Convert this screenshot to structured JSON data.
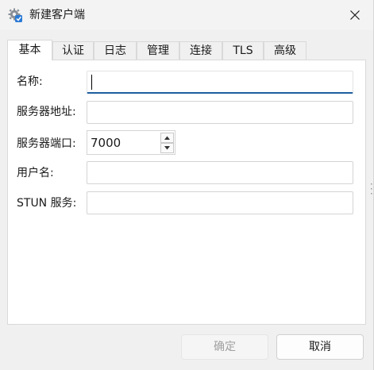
{
  "window": {
    "title": "新建客户端"
  },
  "icons": {
    "app": "gear-check-icon",
    "close": "close-icon",
    "spin_up": "caret-up-icon",
    "spin_down": "caret-down-icon"
  },
  "tabs": [
    {
      "label": "基本",
      "active": true
    },
    {
      "label": "认证",
      "active": false
    },
    {
      "label": "日志",
      "active": false
    },
    {
      "label": "管理",
      "active": false
    },
    {
      "label": "连接",
      "active": false
    },
    {
      "label": "TLS",
      "active": false
    },
    {
      "label": "高级",
      "active": false
    }
  ],
  "form": {
    "name": {
      "label": "名称:",
      "value": ""
    },
    "server_address": {
      "label": "服务器地址:",
      "value": ""
    },
    "server_port": {
      "label": "服务器端口:",
      "value": "7000"
    },
    "username": {
      "label": "用户名:",
      "value": ""
    },
    "stun_server": {
      "label": "STUN 服务:",
      "value": ""
    }
  },
  "buttons": {
    "ok": {
      "label": "确定",
      "enabled": false
    },
    "cancel": {
      "label": "取消",
      "enabled": true
    }
  },
  "colors": {
    "focus_underline": "#1f5e9e",
    "disabled_text": "#a0a0a0"
  }
}
